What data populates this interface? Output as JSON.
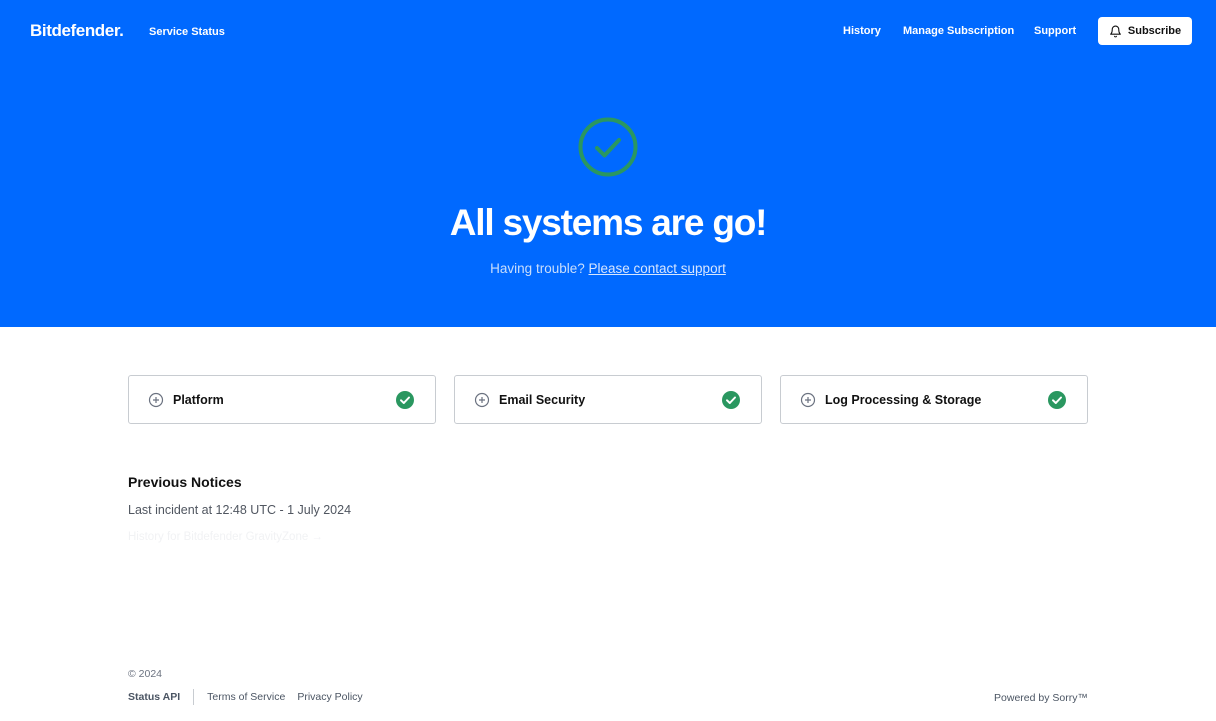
{
  "header": {
    "logo": "Bitdefender.",
    "subtitle": "Service Status",
    "nav": {
      "history": "History",
      "manage": "Manage Subscription",
      "support": "Support"
    },
    "subscribe_label": "Subscribe"
  },
  "hero": {
    "title": "All systems are go!",
    "subtitle_prefix": "Having trouble? ",
    "contact_link": "Please contact support",
    "status_icon": "check-circle-icon"
  },
  "components": [
    {
      "name": "Platform",
      "status": "operational"
    },
    {
      "name": "Email Security",
      "status": "operational"
    },
    {
      "name": "Log Processing & Storage",
      "status": "operational"
    }
  ],
  "notices": {
    "title": "Previous Notices",
    "last_incident": "Last incident at 12:48 UTC - 1 July 2024",
    "history_link": "History for Bitdefender GravityZone →"
  },
  "footer": {
    "copyright": "© 2024",
    "status_api": "Status API",
    "terms": "Terms of Service",
    "privacy": "Privacy Policy",
    "powered_by": "Powered by Sorry™"
  },
  "colors": {
    "brand_blue": "#0069ff",
    "success_green": "#2a9760"
  }
}
